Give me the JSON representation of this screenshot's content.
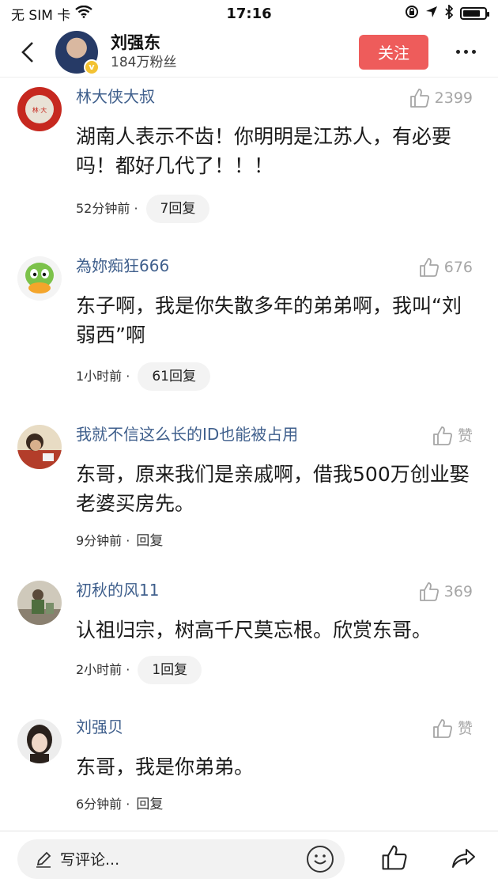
{
  "status_bar": {
    "carrier": "无 SIM 卡",
    "time": "17:16",
    "battery_level": 0.8
  },
  "header": {
    "name": "刘强东",
    "fans": "184万粉丝",
    "follow_label": "关注"
  },
  "comments": [
    {
      "user": "林大侠大叔",
      "likes": "2399",
      "text": "湖南人表示不齿！你明明是江苏人，有必要吗！都好几代了！！！",
      "time": "52分钟前 ·",
      "reply": "7回复",
      "reply_pill": true
    },
    {
      "user": "為妳痴狂666",
      "likes": "676",
      "text": "东子啊，我是你失散多年的弟弟啊，我叫“刘弱西”啊",
      "time": "1小时前 ·",
      "reply": "61回复",
      "reply_pill": true
    },
    {
      "user": "我就不信这么长的ID也能被占用",
      "likes": "赞",
      "text": "东哥，原来我们是亲戚啊，借我500万创业娶老婆买房先。",
      "time": "9分钟前 ·",
      "reply": "回复",
      "reply_pill": false
    },
    {
      "user": "初秋的风11",
      "likes": "369",
      "text": "认祖归宗，树高千尺莫忘根。欣赏东哥。",
      "time": "2小时前 ·",
      "reply": "1回复",
      "reply_pill": true
    },
    {
      "user": "刘强贝",
      "likes": "赞",
      "text": "东哥，我是你弟弟。",
      "time": "6分钟前 ·",
      "reply": "回复",
      "reply_pill": false
    }
  ],
  "bottom_bar": {
    "placeholder": "写评论..."
  },
  "icons": [
    "back-icon",
    "wifi-icon",
    "lock-rotation-icon",
    "location-icon",
    "bluetooth-icon",
    "battery-icon",
    "more-icon",
    "thumbs-up-icon",
    "pencil-icon",
    "emoji-icon",
    "share-icon"
  ],
  "colors": {
    "accent": "#ee5c5b",
    "username": "#3f5f8c",
    "muted": "#a6a6a6"
  }
}
